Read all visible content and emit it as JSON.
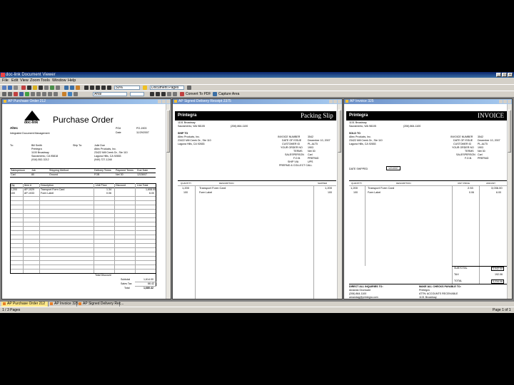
{
  "window": {
    "title": "doc-link Document Viewer",
    "min": "_",
    "max": "□",
    "close": "×"
  },
  "menu": [
    "File",
    "Edit",
    "View",
    "Zoom",
    "Tools",
    "Window",
    "Help"
  ],
  "toolbar": {
    "zoom_value": "50%",
    "page_select": "Document Pages",
    "font_select": "Arial",
    "convert_label": "Convert To PDF",
    "capture_label": "Capture Area"
  },
  "panes": {
    "po": {
      "title": "AP Purchase Order 212",
      "logo_text": "doc-link",
      "heading": "Purchase Order",
      "company": "Altec",
      "company_sub": "Integrated Document Management",
      "po_label": "PO#",
      "po_value": "PO-1903",
      "date_label": "Date",
      "date_value": "11/29/2007",
      "to_label": "To:",
      "to_lines": [
        "Bill Smith",
        "Printegra",
        "1100 Broadway",
        "Sacramento, CA 95818",
        "(916) 552-3212"
      ],
      "shipto_label": "Ship To:",
      "shipto_lines": [
        "Julie Doe",
        "Altec Products, Inc.",
        "23422 Mill Creek Dr., Ste 110",
        "Laguna Hills, CA 92653",
        "(949) 727-1248"
      ],
      "ship_headers": [
        "Salesperson",
        "Job",
        "Shipping Method",
        "Delivery Terms",
        "Payment Terms",
        "Due Date"
      ],
      "ship_values": [
        "Carl",
        "80",
        "Ground",
        "FOB",
        "Net 30",
        "12/28/07"
      ],
      "item_headers": [
        "Qty",
        "Item #",
        "Description",
        "Unit Price",
        "Discount",
        "Line Total"
      ],
      "items": [
        {
          "qty": "1,200",
          "item": "AP-1029",
          "desc": "Transport Form Card",
          "price": "1.34",
          "disc": "",
          "total": "1,608.00"
        },
        {
          "qty": "100",
          "item": "AP-1033",
          "desc": "Form Label",
          "price": "0.06",
          "disc": "",
          "total": "6.00"
        }
      ],
      "total_discount_label": "Total Discount",
      "totals": [
        {
          "label": "Subtotal",
          "value": "1,614.00"
        },
        {
          "label": "Sales Tax",
          "value": "66.42"
        },
        {
          "label": "Total",
          "value": "1,680.42"
        }
      ]
    },
    "ps": {
      "title": "AP Signed Delivery Receipt 2375",
      "brand": "Printegra",
      "heading": "Packing Slip",
      "addr": [
        "1101 Broadway",
        "Sacramento, WA 98105"
      ],
      "phone": "(206) 864-1100",
      "shipto_label": "SHIP TO",
      "shipto_lines": [
        "Altec Products, Inc.",
        "23422 Mill Creek Dr., Ste 110",
        "Laguna Hills, CA 92653"
      ],
      "meta_labels": [
        "INVOICE NUMBER",
        "DATE OF ISSUE",
        "CUSTOMER ID",
        "YOUR ORDER NO",
        "TERMS",
        "SALESPERSON",
        "F.O.B."
      ],
      "meta_values": [
        "3542",
        "December 10, 2007",
        "PL-ALT5",
        "1903",
        "Net 30",
        "Carl",
        "PREPAID"
      ],
      "ship_via_label": "SHIP VIA",
      "ship_via_value": "UPS",
      "prepaid_line": "PREPAID & COLLECT CALL",
      "col_headers": [
        "QUANTITY",
        "DESCRIPTION",
        "SHIPPED"
      ],
      "rows": [
        {
          "qty": "1,200",
          "desc": "Transport Form Card",
          "shipped": "1,200"
        },
        {
          "qty": "100",
          "desc": "Form Label",
          "shipped": "100"
        }
      ]
    },
    "inv": {
      "title": "AP Invoice 325",
      "brand": "Printegra",
      "heading": "INVOICE",
      "addr": [
        "1101 Broadway",
        "Sacramento, WA 98105"
      ],
      "phone": "(206) 864-1100",
      "soldto_label": "SOLD TO",
      "soldto_lines": [
        "Altec Products, Inc.",
        "23422 Mill Creek Dr., Ste 110",
        "Laguna Hills, CA 92653"
      ],
      "meta_labels": [
        "INVOICE NUMBER",
        "DATE OF ISSUE",
        "CUSTOMER ID",
        "YOUR ORDER NO",
        "TERMS",
        "SALESPERSON",
        "F.O.B."
      ],
      "meta_values": [
        "3542",
        "December 10, 2007",
        "PL-ALT5",
        "1903",
        "Net 30",
        "Carl",
        "PREPAID"
      ],
      "date_shipped_label": "DATE SHIPPED",
      "date_shipped_value": "12/10/07",
      "col_headers": [
        "QUANTITY",
        "DESCRIPTION",
        "UNIT PRICE",
        "AMOUNT"
      ],
      "rows": [
        {
          "qty": "1,200",
          "desc": "Transport Form Card",
          "price": "2.53",
          "amount": "3,036.00"
        },
        {
          "qty": "100",
          "desc": "Form Label",
          "price": "0.06",
          "amount": "6.00"
        }
      ],
      "totals": [
        {
          "label": "SUBTOTAL",
          "value": "3,042.00"
        },
        {
          "label": "TAX",
          "value": "192.06"
        },
        {
          "label": "TOTAL",
          "value": "3,234.06"
        }
      ],
      "footer_left": [
        "DIRECT ALL INQUIRIES TO:",
        "Amanda Grunwald",
        "(206) 864-1100",
        "amandag@printegra.com"
      ],
      "footer_right": [
        "MAKE ALL CHECKS PAYABLE TO:",
        "Printegra",
        "ATTN: ACCOUNTS RECEIVABLE",
        "1101 Broadway"
      ]
    }
  },
  "tabs": [
    "AP Purchase Order 212",
    "AP Invoice 325",
    "AP Signed Delivery Rec..."
  ],
  "status": {
    "left": "1 / 3 Pages",
    "right": "Page 1 of 1"
  },
  "colors": {
    "titlebar": "#0a246a",
    "chrome": "#d4d0c8",
    "workspace": "#808080",
    "active_tab": "#ffe88a"
  }
}
